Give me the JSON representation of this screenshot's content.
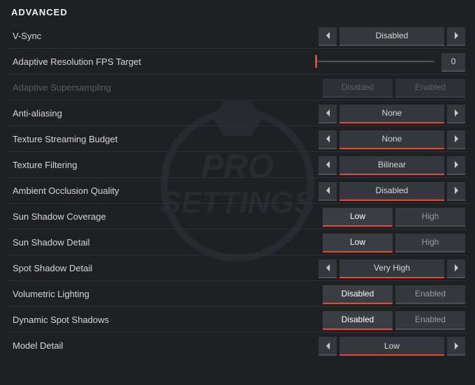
{
  "section_title": "ADVANCED",
  "watermark_text_top": "PRO",
  "watermark_text_bot": "SETTINGS",
  "rows": {
    "vsync": {
      "label": "V-Sync",
      "value": "Disabled"
    },
    "adaptive_fps": {
      "label": "Adaptive Resolution FPS Target",
      "value": "0"
    },
    "adaptive_ss": {
      "label": "Adaptive Supersampling",
      "opt_a": "Disabled",
      "opt_b": "Enabled"
    },
    "aa": {
      "label": "Anti-aliasing",
      "value": "None"
    },
    "texture_stream": {
      "label": "Texture Streaming Budget",
      "value": "None"
    },
    "texture_filter": {
      "label": "Texture Filtering",
      "value": "Bilinear"
    },
    "ao": {
      "label": "Ambient Occlusion Quality",
      "value": "Disabled"
    },
    "sun_cov": {
      "label": "Sun Shadow Coverage",
      "opt_a": "Low",
      "opt_b": "High",
      "selected": "a"
    },
    "sun_detail": {
      "label": "Sun Shadow Detail",
      "opt_a": "Low",
      "opt_b": "High",
      "selected": "a"
    },
    "spot_detail": {
      "label": "Spot Shadow Detail",
      "value": "Very High"
    },
    "vol_light": {
      "label": "Volumetric Lighting",
      "opt_a": "Disabled",
      "opt_b": "Enabled",
      "selected": "a"
    },
    "dyn_spot": {
      "label": "Dynamic Spot Shadows",
      "opt_a": "Disabled",
      "opt_b": "Enabled",
      "selected": "a"
    },
    "model": {
      "label": "Model Detail",
      "value": "Low"
    }
  }
}
